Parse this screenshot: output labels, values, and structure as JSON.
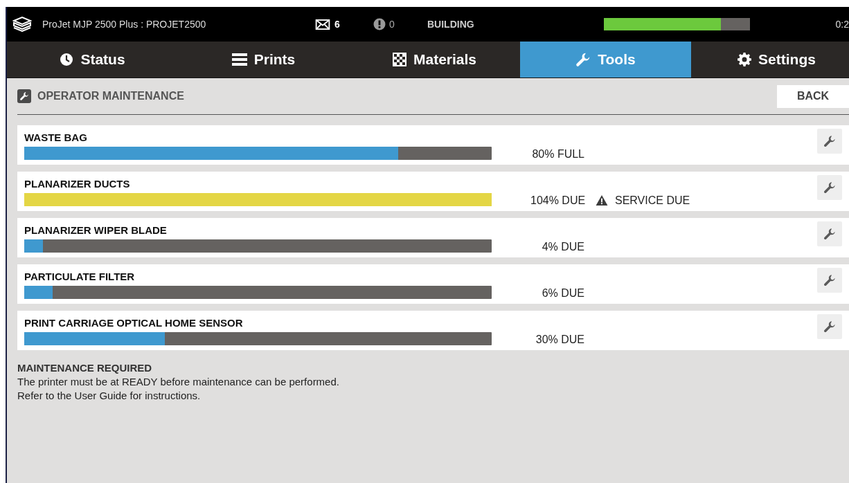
{
  "top_bar": {
    "title": "ProJet MJP 2500 Plus : PROJET2500",
    "messages": "6",
    "alerts": "0",
    "state": "BUILDING",
    "progress": {
      "level": 0.8
    },
    "time": "0:2"
  },
  "tabs": [
    {
      "label": "Status",
      "selected": false
    },
    {
      "label": "Prints",
      "selected": false
    },
    {
      "label": "Materials",
      "selected": false
    },
    {
      "label": "Tools",
      "selected": true
    },
    {
      "label": "Settings",
      "selected": false
    }
  ],
  "header": {
    "title": "OPERATOR MAINTENANCE",
    "back_button": "BACK"
  },
  "items": [
    {
      "name": "WASTE BAG",
      "level": 0.8,
      "color": "#3f99cf",
      "reading": "80% FULL"
    },
    {
      "name": "PLANARIZER DUCTS",
      "level": 1,
      "color": "#e4d645",
      "reading": "104% DUE",
      "warning": "SERVICE DUE"
    },
    {
      "name": "PLANARIZER WIPER BLADE",
      "level": 0.04,
      "color": "#3f99cf",
      "reading": "4% DUE"
    },
    {
      "name": "PARTICULATE FILTER",
      "level": 0.06,
      "color": "#3f99cf",
      "reading": "6% DUE"
    },
    {
      "name": "PRINT CARRIAGE OPTICAL HOME SENSOR",
      "level": 0.3,
      "color": "#3f99cf",
      "reading": "30% DUE"
    }
  ],
  "notice": {
    "title": "MAINTENANCE REQUIRED",
    "lines": [
      "The printer must be at READY before maintenance can be performed.",
      "Refer to the User Guide for instructions."
    ]
  }
}
